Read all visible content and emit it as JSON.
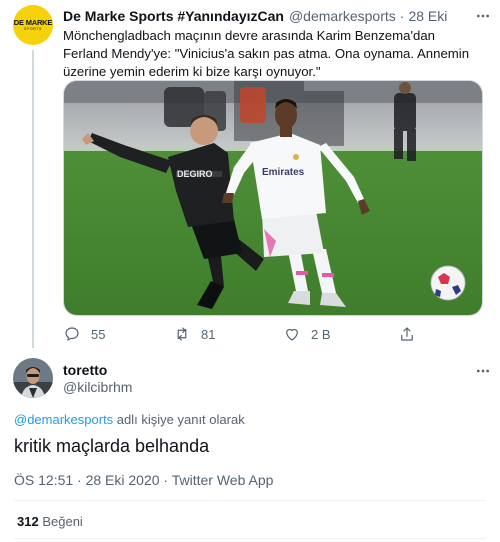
{
  "original_tweet": {
    "avatar_logo": {
      "main": "DE MARKE",
      "sub": "SPORTS"
    },
    "display_name": "De Marke Sports #YanındayızCan",
    "handle": "@demarkesports",
    "separator": "·",
    "timestamp": "28 Eki",
    "text": "Mönchengladbach maçının devre arasında Karim Benzema'dan Ferland Mendy'ye: \"Vinicius'a sakın pas atma. Ona oynama. Annemin üzerine yemin ederim ki bize karşı oynuyor.\"",
    "media": {
      "jersey_sponsor": "Emirates",
      "jersey_sponsor_opponent": "DEGIRO"
    },
    "actions": {
      "replies": "55",
      "retweets": "81",
      "likes": "2 B"
    },
    "icons": [
      "more-icon",
      "reply-icon",
      "retweet-icon",
      "like-icon",
      "share-icon"
    ]
  },
  "reply_tweet": {
    "display_name": "toretto",
    "handle": "@kilcibrhm",
    "replying_to_handle": "@demarkesports",
    "replying_to_suffix": " adlı kişiye yanıt olarak",
    "text": "kritik maçlarda belhanda",
    "meta": "ÖS 12:51 · 28 Eki 2020 · Twitter Web App",
    "like_count": "312",
    "like_label": "Beğeni"
  },
  "colors": {
    "text_primary": "#0f1419",
    "text_secondary": "#536471",
    "link": "#1d9bf0",
    "avatar_bg": "#f5d20a",
    "border": "#cfd9de"
  }
}
